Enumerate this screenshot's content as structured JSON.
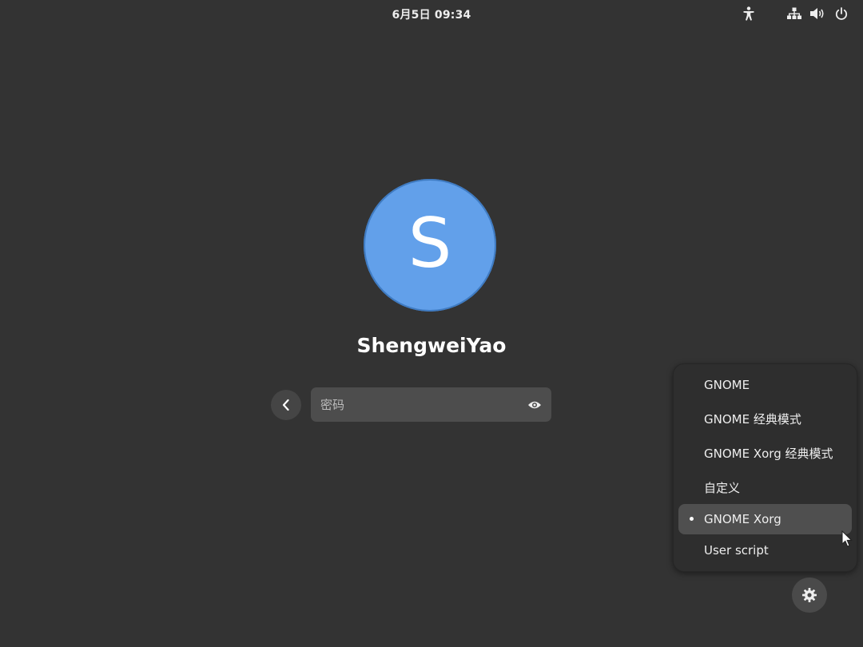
{
  "topbar": {
    "clock": "6月5日  09:34",
    "icons": {
      "accessibility": "accessibility-icon",
      "network": "network-wired-icon",
      "volume": "volume-icon",
      "power": "power-icon"
    }
  },
  "user": {
    "avatar_initial": "S",
    "name": "ShengweiYao",
    "avatar_color": "#62a0ea"
  },
  "login": {
    "password_placeholder": "密码",
    "password_value": "",
    "back_icon": "chevron-left-icon",
    "reveal_icon": "eye-icon"
  },
  "session_menu": {
    "items": [
      {
        "label": "GNOME",
        "selected": false
      },
      {
        "label": "GNOME 经典模式",
        "selected": false
      },
      {
        "label": "GNOME Xorg 经典模式",
        "selected": false
      },
      {
        "label": "自定义",
        "selected": false
      },
      {
        "label": "GNOME Xorg",
        "selected": true
      },
      {
        "label": "User script",
        "selected": false
      }
    ]
  },
  "settings_icon": "gear-icon",
  "colors": {
    "background": "#333333",
    "accent": "#62a0ea"
  }
}
